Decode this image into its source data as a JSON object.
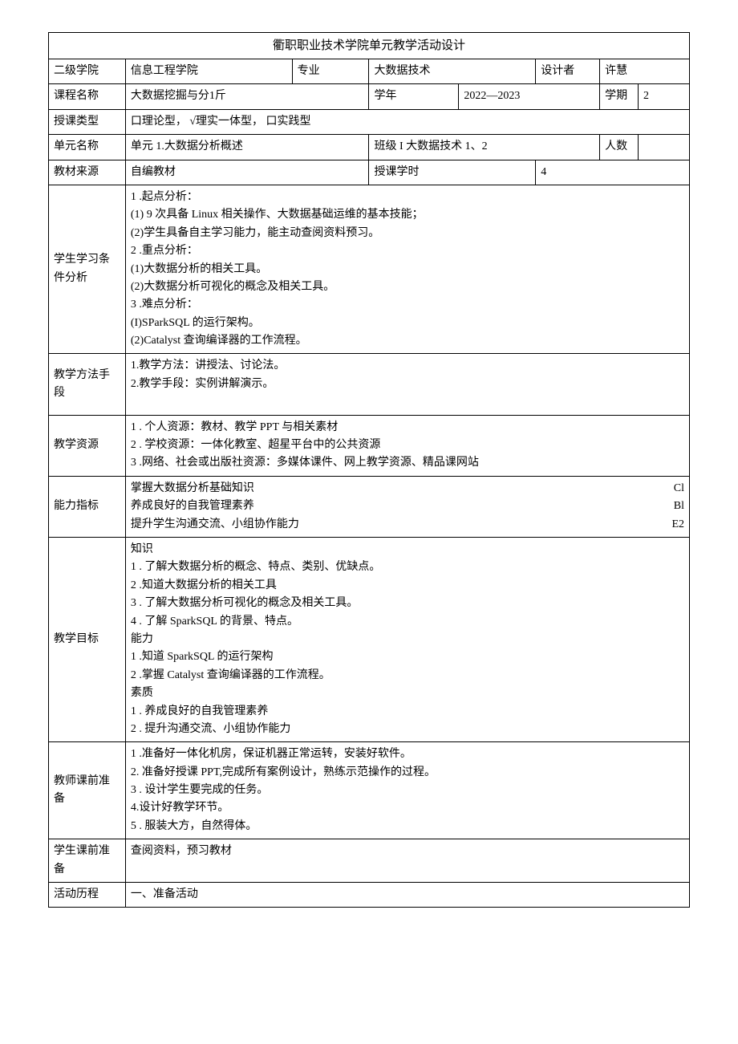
{
  "title": "衢职职业技术学院单元教学活动设计",
  "row1": {
    "l1": "二级学院",
    "v1": "信息工程学院",
    "l2": "专业",
    "v2": "大数据技术",
    "l3": "设计者",
    "v3": "许慧"
  },
  "row2": {
    "l1": "课程名称",
    "v1": "大数据挖掘与分1斤",
    "l2": "学年",
    "v2": "2022—2023",
    "l3": "学期",
    "v3": "2"
  },
  "row3": {
    "l1": "授课类型",
    "v1": "口理论型，     √理实一体型，     口实践型"
  },
  "row4": {
    "l1": "单元名称",
    "v1": "单元 1.大数据分析概述",
    "l2": "班级 I 大数据技术 1、2",
    "l3": "人数",
    "v3": ""
  },
  "row5": {
    "l1": "教材来源",
    "v1": "自编教材",
    "l2": "授课学时",
    "v2": "4"
  },
  "studyCond": {
    "label": "学生学习条件分析",
    "text": "1      .起点分析：\n(1) 9 次具备 Linux 相关操作、大数据基础运维的基本技能；\n(2)学生具备自主学习能力，能主动查阅资料预习。\n2      .重点分析：\n(1)大数据分析的相关工具。\n(2)大数据分析可视化的概念及相关工具。\n3      .难点分析：\n(I)SParkSQL 的运行架构。\n(2)Catalyst 查询编译器的工作流程。"
  },
  "method": {
    "label": "教学方法手段",
    "text": "1.教学方法：讲授法、讨论法。\n2.教学手段：实例讲解演示。\n\n"
  },
  "resource": {
    "label": "教学资源",
    "text": "1       . 个人资源：教材、教学 PPT 与相关素材\n2       . 学校资源：一体化教室、超星平台中的公共资源\n3       .网络、社会或出版社资源：多媒体课件、网上教学资源、精品课网站"
  },
  "ability": {
    "label": "能力指标",
    "r1t": "掌握大数据分析基础知识",
    "r1c": "Cl",
    "r2t": "养成良好的自我管理素养",
    "r2c": "Bl",
    "r3t": "提升学生沟通交流、小组协作能力",
    "r3c": "E2"
  },
  "goal": {
    "label": "教学目标",
    "text": "知识\n1       . 了解大数据分析的概念、特点、类别、优缺点。\n2       .知道大数据分析的相关工具\n3       . 了解大数据分析可视化的概念及相关工具。\n4       . 了解 SparkSQL 的背景、特点。\n能力\n1       .知道 SparkSQL 的运行架构\n2       .掌握 Catalyst 查询编译器的工作流程。\n素质\n1       . 养成良好的自我管理素养\n2       . 提升沟通交流、小组协作能力"
  },
  "teacherPrep": {
    "label": "教师课前准备",
    "text": "1       .准备好一体化机房，保证机器正常运转，安装好软件。\n2. 准备好授课 PPT,完成所有案例设计，熟练示范操作的过程。\n3       . 设计学生要完成的任务。\n4.设计好教学环节。\n5       . 服装大方，自然得体。\n"
  },
  "studentPrep": {
    "label": "学生课前准备",
    "text": "查阅资料，预习教材"
  },
  "process": {
    "label": "活动历程",
    "text": "一、准备活动"
  }
}
